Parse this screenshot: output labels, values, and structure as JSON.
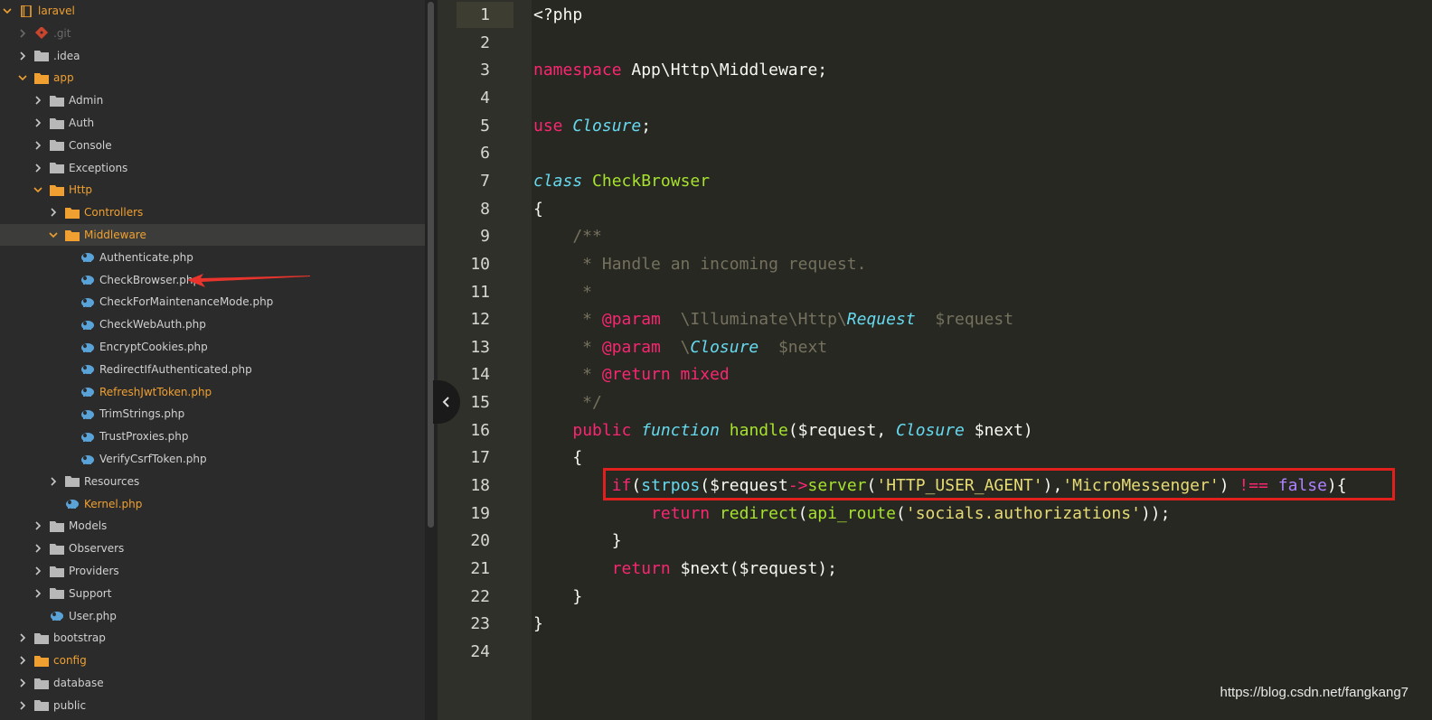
{
  "colors": {
    "folder_orange": "#f0a030",
    "folder_grey": "#b8b8b8",
    "php_file_icon": "#5aa3d8",
    "highlight_red": "#e0201c"
  },
  "tree": [
    {
      "label": "laravel",
      "type": "project",
      "state": "open",
      "orange": true
    },
    {
      "label": ".git",
      "type": "git",
      "state": "closed",
      "dim": true
    },
    {
      "label": ".idea",
      "type": "folder",
      "state": "closed"
    },
    {
      "label": "app",
      "type": "folder",
      "state": "open",
      "orange": true
    },
    {
      "label": "Admin",
      "type": "folder",
      "state": "closed"
    },
    {
      "label": "Auth",
      "type": "folder",
      "state": "closed"
    },
    {
      "label": "Console",
      "type": "folder",
      "state": "closed"
    },
    {
      "label": "Exceptions",
      "type": "folder",
      "state": "closed"
    },
    {
      "label": "Http",
      "type": "folder",
      "state": "open",
      "orange": true
    },
    {
      "label": "Controllers",
      "type": "folder",
      "state": "closed",
      "orange": true
    },
    {
      "label": "Middleware",
      "type": "folder",
      "state": "open",
      "orange": true,
      "selected": true
    },
    {
      "label": "Authenticate.php",
      "type": "php"
    },
    {
      "label": "CheckBrowser.php",
      "type": "php"
    },
    {
      "label": "CheckForMaintenanceMode.php",
      "type": "php"
    },
    {
      "label": "CheckWebAuth.php",
      "type": "php"
    },
    {
      "label": "EncryptCookies.php",
      "type": "php"
    },
    {
      "label": "RedirectIfAuthenticated.php",
      "type": "php"
    },
    {
      "label": "RefreshJwtToken.php",
      "type": "php",
      "orange": true
    },
    {
      "label": "TrimStrings.php",
      "type": "php"
    },
    {
      "label": "TrustProxies.php",
      "type": "php"
    },
    {
      "label": "VerifyCsrfToken.php",
      "type": "php"
    },
    {
      "label": "Resources",
      "type": "folder",
      "state": "closed"
    },
    {
      "label": "Kernel.php",
      "type": "php",
      "orange": true
    },
    {
      "label": "Models",
      "type": "folder",
      "state": "closed"
    },
    {
      "label": "Observers",
      "type": "folder",
      "state": "closed"
    },
    {
      "label": "Providers",
      "type": "folder",
      "state": "closed"
    },
    {
      "label": "Support",
      "type": "folder",
      "state": "closed"
    },
    {
      "label": "User.php",
      "type": "php"
    },
    {
      "label": "bootstrap",
      "type": "folder",
      "state": "closed"
    },
    {
      "label": "config",
      "type": "folder",
      "state": "closed",
      "orange": true
    },
    {
      "label": "database",
      "type": "folder",
      "state": "closed"
    },
    {
      "label": "public",
      "type": "folder",
      "state": "closed"
    }
  ],
  "tree_indent": [
    0,
    1,
    1,
    1,
    2,
    2,
    2,
    2,
    2,
    3,
    3,
    4,
    4,
    4,
    4,
    4,
    4,
    4,
    4,
    4,
    4,
    3,
    3,
    2,
    2,
    2,
    2,
    2,
    1,
    1,
    1,
    1
  ],
  "code": {
    "line_numbers": [
      "1",
      "2",
      "3",
      "4",
      "5",
      "6",
      "7",
      "8",
      "9",
      "10",
      "11",
      "12",
      "13",
      "14",
      "15",
      "16",
      "17",
      "18",
      "19",
      "20",
      "21",
      "22",
      "23",
      "24"
    ],
    "lines": [
      [
        [
          "t",
          "<?php"
        ]
      ],
      [],
      [
        [
          "kw",
          "namespace"
        ],
        [
          "t",
          " App\\Http\\Middleware;"
        ]
      ],
      [],
      [
        [
          "kw",
          "use"
        ],
        [
          "t",
          " "
        ],
        [
          "it",
          "Closure"
        ],
        [
          "t",
          ";"
        ]
      ],
      [],
      [
        [
          "it",
          "class"
        ],
        [
          "t",
          " "
        ],
        [
          "cls",
          "CheckBrowser"
        ]
      ],
      [
        [
          "t",
          "{"
        ]
      ],
      [
        [
          "cm",
          "    /**"
        ]
      ],
      [
        [
          "cm",
          "     * Handle an incoming request."
        ]
      ],
      [
        [
          "cm",
          "     *"
        ]
      ],
      [
        [
          "cm",
          "     * "
        ],
        [
          "tag",
          "@param"
        ],
        [
          "cm",
          "  \\Illuminate\\Http\\"
        ],
        [
          "it",
          "Request"
        ],
        [
          "cm",
          "  $request"
        ]
      ],
      [
        [
          "cm",
          "     * "
        ],
        [
          "tag",
          "@param"
        ],
        [
          "cm",
          "  \\"
        ],
        [
          "it",
          "Closure"
        ],
        [
          "cm",
          "  $next"
        ]
      ],
      [
        [
          "cm",
          "     * "
        ],
        [
          "tag",
          "@return mixed"
        ]
      ],
      [
        [
          "cm",
          "     */"
        ]
      ],
      [
        [
          "t",
          "    "
        ],
        [
          "kw",
          "public"
        ],
        [
          "t",
          " "
        ],
        [
          "it",
          "function"
        ],
        [
          "t",
          " "
        ],
        [
          "fn",
          "handle"
        ],
        [
          "t",
          "($request, "
        ],
        [
          "it",
          "Closure"
        ],
        [
          "t",
          " $next)"
        ]
      ],
      [
        [
          "t",
          "    {"
        ]
      ],
      [
        [
          "t",
          "        "
        ],
        [
          "kw",
          "if"
        ],
        [
          "t",
          "("
        ],
        [
          "it2",
          "strpos"
        ],
        [
          "t",
          "($request"
        ],
        [
          "kw",
          "->"
        ],
        [
          "fn",
          "server"
        ],
        [
          "t",
          "("
        ],
        [
          "str",
          "'HTTP_USER_AGENT'"
        ],
        [
          "t",
          "),"
        ],
        [
          "str",
          "'MicroMessenger'"
        ],
        [
          "t",
          ") "
        ],
        [
          "kw",
          "!=="
        ],
        [
          "t",
          " "
        ],
        [
          "bool",
          "false"
        ],
        [
          "t",
          "){"
        ]
      ],
      [
        [
          "t",
          "            "
        ],
        [
          "kw",
          "return"
        ],
        [
          "t",
          " "
        ],
        [
          "fn",
          "redirect"
        ],
        [
          "t",
          "("
        ],
        [
          "fn",
          "api_route"
        ],
        [
          "t",
          "("
        ],
        [
          "str",
          "'socials.authorizations'"
        ],
        [
          "t",
          "));"
        ]
      ],
      [
        [
          "t",
          "        }"
        ]
      ],
      [
        [
          "t",
          "        "
        ],
        [
          "kw",
          "return"
        ],
        [
          "t",
          " $next($request);"
        ]
      ],
      [
        [
          "t",
          "    }"
        ]
      ],
      [
        [
          "t",
          "}"
        ]
      ],
      []
    ]
  },
  "watermark": "https://blog.csdn.net/fangkang7"
}
